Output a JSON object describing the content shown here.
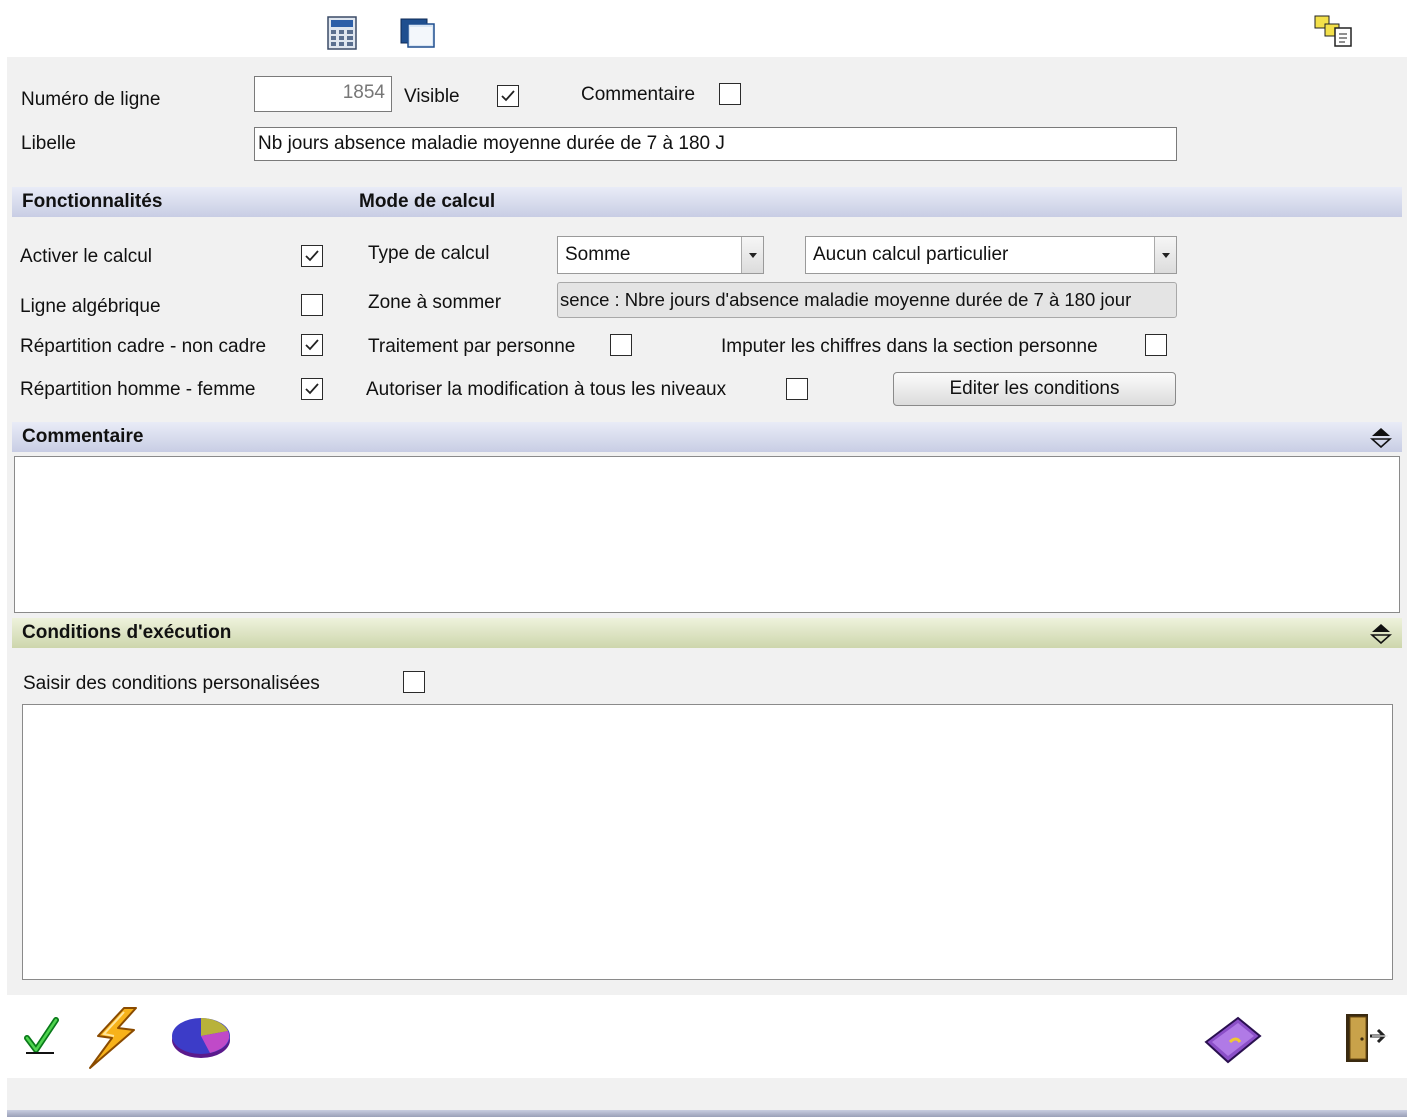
{
  "toolbar_top": {
    "calculator_icon": "calculator-icon",
    "window_icon": "window-icon",
    "copy_icon": "copy-icon"
  },
  "form": {
    "line_number_label": "Numéro de ligne",
    "line_number_value": "1854",
    "visible_label": "Visible",
    "visible_checked": true,
    "comment_label": "Commentaire",
    "comment_checked": false,
    "libelle_label": "Libelle",
    "libelle_value": "Nb jours absence maladie moyenne durée de 7 à 180 J"
  },
  "sections": {
    "fonctionnalites": "Fonctionnalités",
    "mode_calcul": "Mode de calcul",
    "commentaire": "Commentaire",
    "conditions": "Conditions d'exécution"
  },
  "features": {
    "activer_calcul": {
      "label": "Activer le calcul",
      "checked": true
    },
    "ligne_algebrique": {
      "label": "Ligne algébrique",
      "checked": false
    },
    "repartition_cadre": {
      "label": "Répartition cadre - non cadre",
      "checked": true
    },
    "repartition_homme": {
      "label": "Répartition homme - femme",
      "checked": true
    }
  },
  "calc": {
    "type_label": "Type de calcul",
    "type_value": "Somme",
    "special_value": "Aucun calcul particulier",
    "zone_label": "Zone à sommer",
    "zone_value": "sence : Nbre jours d'absence maladie moyenne durée de 7 à 180 jour",
    "traitement_label": "Traitement par personne",
    "traitement_checked": false,
    "imputer_label": "Imputer les chiffres dans la section personne",
    "imputer_checked": false,
    "autoriser_label": "Autoriser la modification à tous les niveaux",
    "autoriser_checked": false,
    "edit_button": "Editer les conditions"
  },
  "conditions": {
    "custom_label": "Saisir des conditions personalisées",
    "custom_checked": false
  },
  "colors": {
    "panel_bg": "#f1f1f1",
    "header_blue": "#c8cde4",
    "header_green": "#cdd6ac"
  }
}
